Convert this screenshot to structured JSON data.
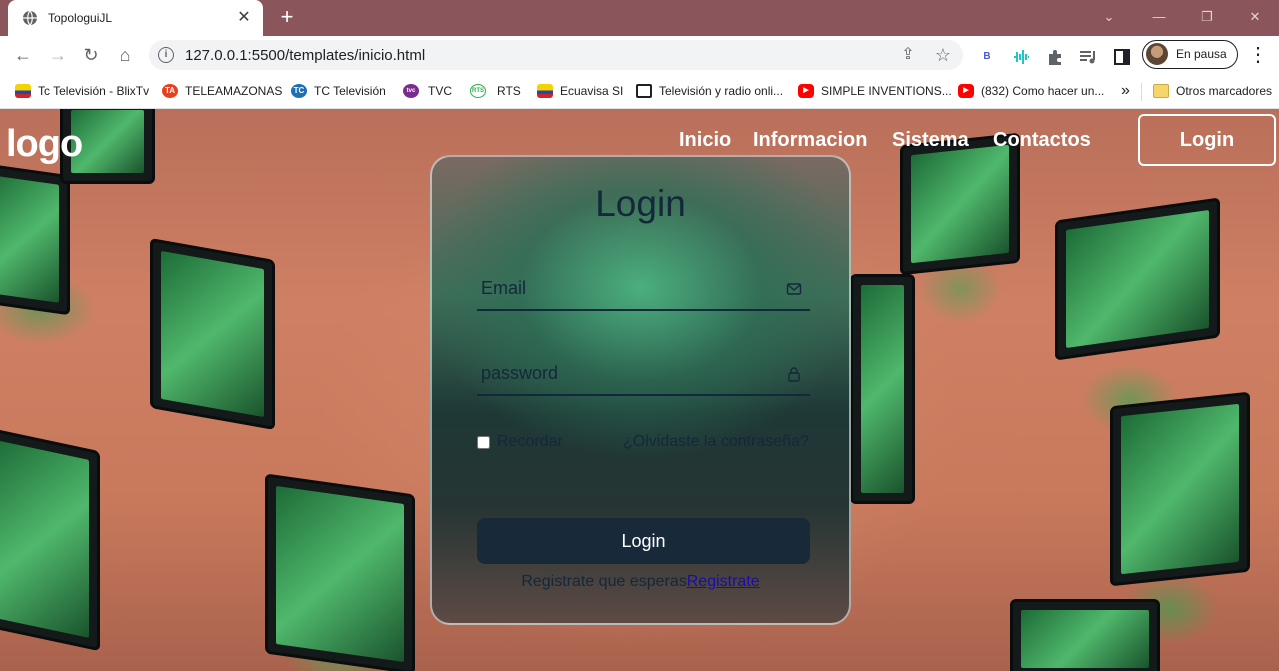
{
  "browser": {
    "tab": {
      "title": "TopologuiJL",
      "close_symbol": "✕"
    },
    "new_tab_symbol": "+",
    "window_controls": {
      "dropdown": "⌄",
      "minimize": "—",
      "restore": "❐",
      "close": "✕"
    },
    "toolbar": {
      "back": "←",
      "forward": "→",
      "reload": "↻",
      "home": "⌂",
      "url": "127.0.0.1:5500/templates/inicio.html",
      "share_symbol": "⇪",
      "star_symbol": "☆",
      "profile_label": "En pausa",
      "menu_symbol": "⋮"
    },
    "bookmarks": [
      {
        "label": "Tc Televisión - BlixTv",
        "icon": "flag-ecuador-icon",
        "color": "#d4a017"
      },
      {
        "label": "TELEAMAZONAS",
        "icon": "teleamazonas-icon",
        "color": "#e8401c",
        "text": "TA"
      },
      {
        "label": "TC Televisión",
        "icon": "tc-icon",
        "color": "#1f6fb5",
        "text": "TC"
      },
      {
        "label": "TVC",
        "icon": "tvc-icon",
        "color": "#7a2d8e",
        "text": "tvc"
      },
      {
        "label": "RTS",
        "icon": "rts-icon",
        "color": "#2bb24c",
        "text": "RTS"
      },
      {
        "label": "Ecuavisa SI",
        "icon": "flag-ecuador-icon",
        "color": "#d4a017"
      },
      {
        "label": "Televisión y radio onli...",
        "icon": "tv-icon",
        "color": "#202124"
      },
      {
        "label": "SIMPLE INVENTIONS...",
        "icon": "youtube-icon",
        "color": "#ff0000"
      },
      {
        "label": "(832) Como hacer un...",
        "icon": "youtube-icon",
        "color": "#ff0000"
      }
    ],
    "bookmarks_overflow": "»",
    "other_bookmarks": "Otros marcadores"
  },
  "page": {
    "logo": "logo",
    "nav": [
      "Inicio",
      "Informacion",
      "Sistema",
      "Contactos"
    ],
    "nav_login": "Login",
    "login_card": {
      "title": "Login",
      "email_placeholder": "Email",
      "password_placeholder": "password",
      "remember_label": "Recordar",
      "forgot_label": "¿Olvidaste la contraseña?",
      "submit_label": "Login",
      "register_text": "Registrate que esperas",
      "register_link": "Registrate"
    }
  }
}
